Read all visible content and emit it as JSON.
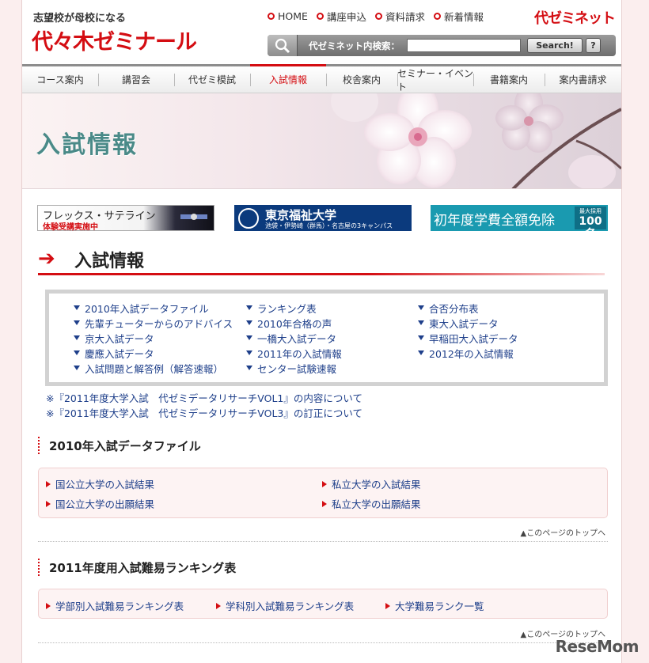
{
  "header": {
    "tagline": "志望校が母校になる",
    "logo": "代々木ゼミナール",
    "brand": "代ゼミネット",
    "toplinks": [
      "HOME",
      "講座申込",
      "資料請求",
      "新着情報"
    ],
    "search": {
      "label": "代ゼミネット内検索：",
      "value": "",
      "button": "Search!",
      "help": "?"
    }
  },
  "nav": {
    "items": [
      "コース案内",
      "講習会",
      "代ゼミ模試",
      "入試情報",
      "校舎案内",
      "セミナー・イベント",
      "書籍案内",
      "案内書請求"
    ],
    "active_index": 3
  },
  "hero": {
    "title": "入試情報"
  },
  "banners": {
    "flex": {
      "title": "フレックス・サテライン",
      "sub": "体験受講実施中"
    },
    "tokyo": {
      "title": "東京福祉大学",
      "sub": "池袋・伊勢崎（群馬）・名古屋の3キャンパス"
    },
    "scholar": {
      "title": "初年度学費全額免除",
      "badge_small": "最大採用",
      "badge_num": "100名"
    }
  },
  "section": {
    "title": "入試情報"
  },
  "links": {
    "col1": [
      "2010年入試データファイル",
      "先輩チューターからのアドバイス",
      "京大入試データ",
      "慶應入試データ",
      "入試問題と解答例（解答速報）"
    ],
    "col2": [
      "ランキング表",
      "2010年合格の声",
      "一橋大入試データ",
      "2011年の入試情報",
      "センター試験速報"
    ],
    "col3": [
      "合否分布表",
      "東大入試データ",
      "早稲田大入試データ",
      "2012年の入試情報"
    ]
  },
  "notes": [
    "※『2011年度大学入試　代ゼミデータリサーチVOL1』の内容について",
    "※『2011年度大学入試　代ゼミデータリサーチVOL3』の訂正について"
  ],
  "datafile": {
    "title": "2010年入試データファイル",
    "links": [
      "国公立大学の入試結果",
      "私立大学の入試結果",
      "国公立大学の出願結果",
      "私立大学の出願結果"
    ]
  },
  "ranking": {
    "title": "2011年度用入試難易ランキング表",
    "links": [
      "学部別入試難易ランキング表",
      "学科別入試難易ランキング表",
      "大学難易ランク一覧"
    ]
  },
  "totop": "▲このページのトップへ",
  "watermark": "ReseMom"
}
